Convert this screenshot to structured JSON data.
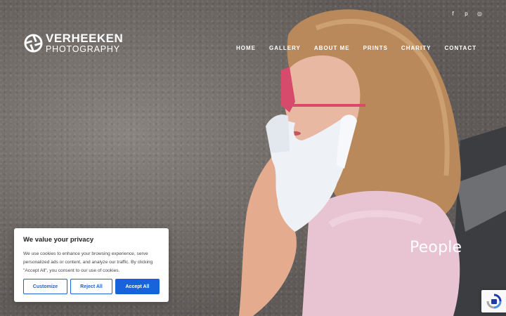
{
  "brand": {
    "line1": "VERHEEKEN",
    "line2": "PHOTOGRAPHY"
  },
  "social": [
    {
      "icon": "facebook-icon",
      "glyph": "f"
    },
    {
      "icon": "pinterest-icon",
      "glyph": "p"
    },
    {
      "icon": "instagram-icon",
      "glyph": "◎"
    }
  ],
  "nav": [
    "HOME",
    "GALLERY",
    "ABOUT ME",
    "PRINTS",
    "CHARITY",
    "CONTACT"
  ],
  "hero": {
    "title": "People"
  },
  "cookie": {
    "title": "We value your privacy",
    "text": "We use cookies to enhance your browsing experience, serve personalized ads or content, and analyze our traffic. By clicking \"Accept All\", you consent to our use of cookies.",
    "customize_label": "Customize",
    "reject_label": "Reject All",
    "accept_label": "Accept All",
    "accent": "#1863dc"
  },
  "recaptcha": {
    "icon": "recaptcha-icon"
  }
}
